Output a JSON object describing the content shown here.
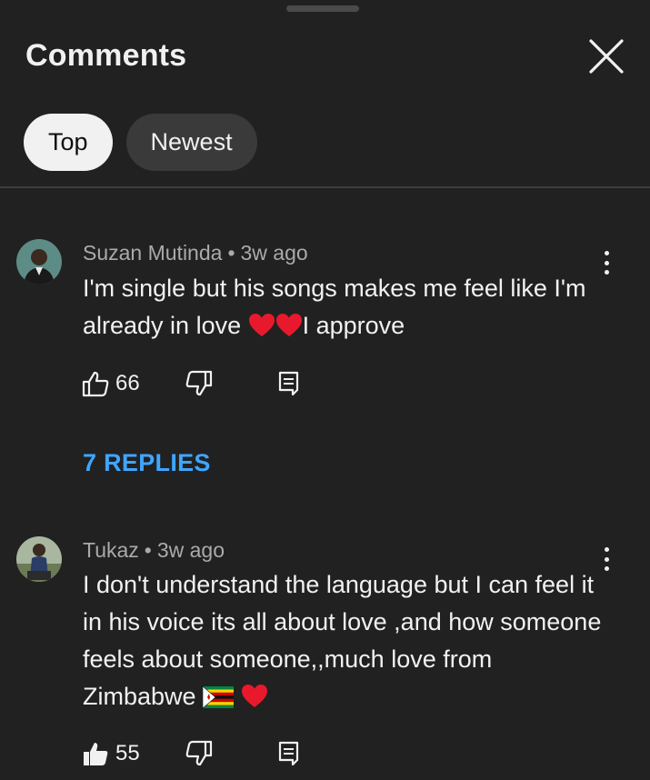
{
  "header": {
    "title": "Comments"
  },
  "tabs": [
    {
      "label": "Top",
      "active": true
    },
    {
      "label": "Newest",
      "active": false
    }
  ],
  "comments": [
    {
      "author": "Suzan Mutinda",
      "time": "3w ago",
      "text_before": "I'm single but his songs makes me feel like I'm already in love ",
      "text_after": "I approve",
      "likes": "66",
      "replies_label": "7 REPLIES"
    },
    {
      "author": "Tukaz",
      "time": "3w ago",
      "text_before": "I don't understand the language but I can feel it in his voice its all about love ,and how someone feels about someone,,much love from Zimbabwe ",
      "text_after": "",
      "likes": "55"
    }
  ],
  "icons": {
    "close": "close-icon",
    "like": "thumbs-up-icon",
    "dislike": "thumbs-down-icon",
    "reply": "comment-icon",
    "menu": "more-vert-icon",
    "heart": "red-heart-emoji",
    "flag": "zimbabwe-flag-emoji"
  },
  "colors": {
    "background": "#212121",
    "accent_link": "#3ea6ff",
    "heart": "#e8192c"
  }
}
